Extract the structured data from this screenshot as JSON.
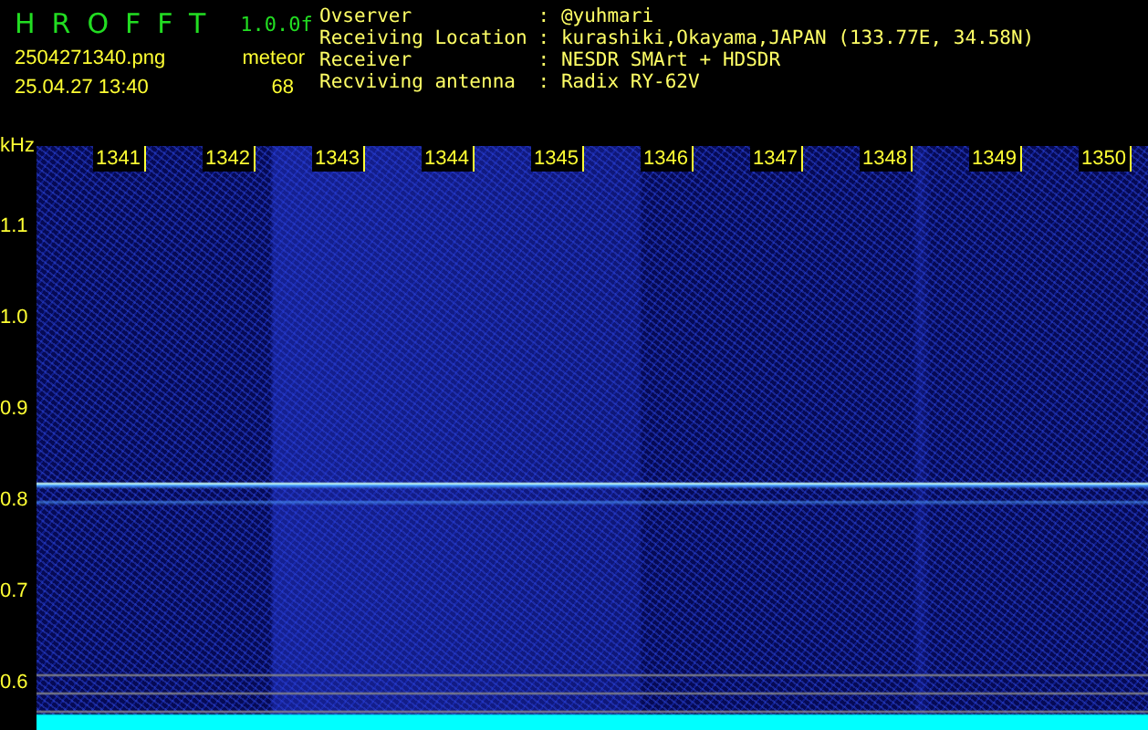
{
  "header": {
    "title": "HROFFT",
    "version": "1.0.0f",
    "filename": "2504271340.png",
    "datetime": "25.04.27 13:40",
    "meteor_label": "meteor",
    "meteor_count": "68"
  },
  "info": [
    {
      "label": "Ovserver",
      "value": ": @yuhmari"
    },
    {
      "label": "Receiving Location",
      "value": ": kurashiki,Okayama,JAPAN (133.77E, 34.58N)"
    },
    {
      "label": "Receiver",
      "value": ": NESDR SMArt + HDSDR"
    },
    {
      "label": "Recviving antenna",
      "value": ": Radix RY-62V"
    }
  ],
  "spectrogram": {
    "unit": "kHz",
    "x_ticks": [
      "1341",
      "1342",
      "1343",
      "1344",
      "1345",
      "1346",
      "1347",
      "1348",
      "1349",
      "1350"
    ],
    "y_ticks": [
      "1.1",
      "1.0",
      "0.9",
      "0.8",
      "0.7",
      "0.6"
    ]
  }
}
